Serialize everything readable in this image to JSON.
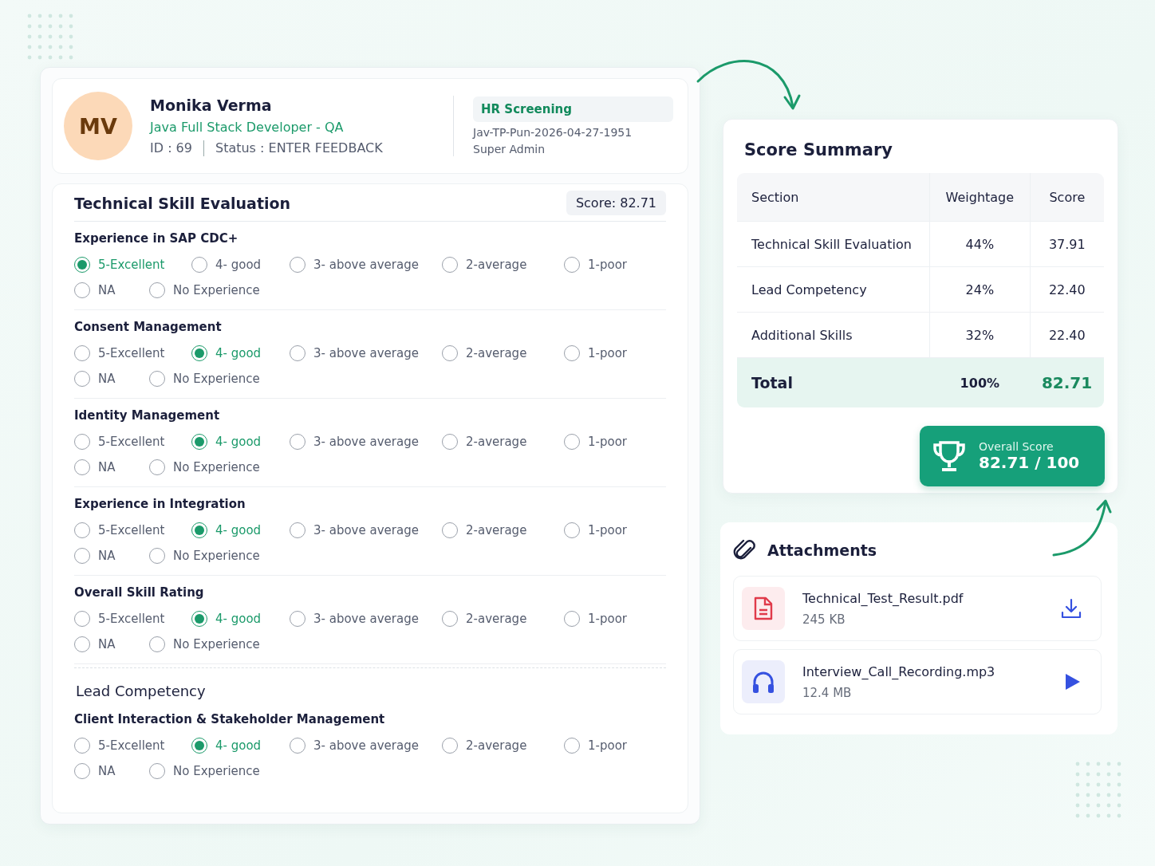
{
  "candidate": {
    "initials": "MV",
    "name": "Monika Verma",
    "role": "Java Full Stack Developer - QA",
    "id": "ID : 69",
    "status": "Status : ENTER FEEDBACK",
    "stage": "HR Screening",
    "code": "Jav-TP-Pun-2026-04-27-1951",
    "owner": "Super Admin"
  },
  "sections": [
    {
      "kind": "scored",
      "title": "Technical Skill Evaluation",
      "score": "Score: 82.71",
      "questions": [
        {
          "title": "Experience in SAP CDC+",
          "options": [
            {
              "label": "5-Excellent",
              "selected": true
            },
            {
              "label": "4- good",
              "selected": false
            },
            {
              "label": "3- above average",
              "selected": false
            },
            {
              "label": "2-average",
              "selected": false
            },
            {
              "label": "1-poor",
              "selected": false
            },
            {
              "label": "NA",
              "selected": false
            },
            {
              "label": "No Experience",
              "selected": false
            }
          ]
        },
        {
          "title": "Consent Management",
          "options": [
            {
              "label": "5-Excellent",
              "selected": false
            },
            {
              "label": "4- good",
              "selected": true
            },
            {
              "label": "3- above average",
              "selected": false
            },
            {
              "label": "2-average",
              "selected": false
            },
            {
              "label": "1-poor",
              "selected": false
            },
            {
              "label": "NA",
              "selected": false
            },
            {
              "label": "No Experience",
              "selected": false
            }
          ]
        },
        {
          "title": "Identity Management",
          "options": [
            {
              "label": "5-Excellent",
              "selected": false
            },
            {
              "label": "4- good",
              "selected": true
            },
            {
              "label": "3- above average",
              "selected": false
            },
            {
              "label": "2-average",
              "selected": false
            },
            {
              "label": "1-poor",
              "selected": false
            },
            {
              "label": "NA",
              "selected": false
            },
            {
              "label": "No Experience",
              "selected": false
            }
          ]
        },
        {
          "title": "Experience in Integration",
          "options": [
            {
              "label": "5-Excellent",
              "selected": false
            },
            {
              "label": "4- good",
              "selected": true
            },
            {
              "label": "3- above average",
              "selected": false
            },
            {
              "label": "2-average",
              "selected": false
            },
            {
              "label": "1-poor",
              "selected": false
            },
            {
              "label": "NA",
              "selected": false
            },
            {
              "label": "No Experience",
              "selected": false
            }
          ]
        },
        {
          "title": "Overall Skill Rating",
          "options": [
            {
              "label": "5-Excellent",
              "selected": false
            },
            {
              "label": "4- good",
              "selected": true
            },
            {
              "label": "3- above average",
              "selected": false
            },
            {
              "label": "2-average",
              "selected": false
            },
            {
              "label": "1-poor",
              "selected": false
            },
            {
              "label": "NA",
              "selected": false
            },
            {
              "label": "No Experience",
              "selected": false
            }
          ]
        }
      ]
    },
    {
      "kind": "plain",
      "title": "Lead Competency",
      "questions": [
        {
          "title": "Client Interaction & Stakeholder Management",
          "options": [
            {
              "label": "5-Excellent",
              "selected": false
            },
            {
              "label": "4- good",
              "selected": true
            },
            {
              "label": "3- above average",
              "selected": false
            },
            {
              "label": "2-average",
              "selected": false
            },
            {
              "label": "1-poor",
              "selected": false
            },
            {
              "label": "NA",
              "selected": false
            },
            {
              "label": "No Experience",
              "selected": false
            }
          ]
        }
      ]
    }
  ],
  "score_summary": {
    "title": "Score Summary",
    "columns": [
      "Section",
      "Weightage",
      "Score"
    ],
    "rows": [
      [
        "Technical Skill Evaluation",
        "44%",
        "37.91"
      ],
      [
        "Lead Competency",
        "24%",
        "22.40"
      ],
      [
        "Additional Skills",
        "32%",
        "22.40"
      ]
    ],
    "total": [
      "Total",
      "100%",
      "82.71"
    ],
    "overall": {
      "label": "Overall Score",
      "value": "82.71 / 100"
    }
  },
  "attachments": {
    "title": "Attachments",
    "files": [
      {
        "kind": "document",
        "name": "Technical_Test_Result.pdf",
        "size": "245 KB"
      },
      {
        "kind": "audio",
        "name": "Interview_Call_Recording.mp3",
        "size": "12.4 MB"
      }
    ]
  }
}
